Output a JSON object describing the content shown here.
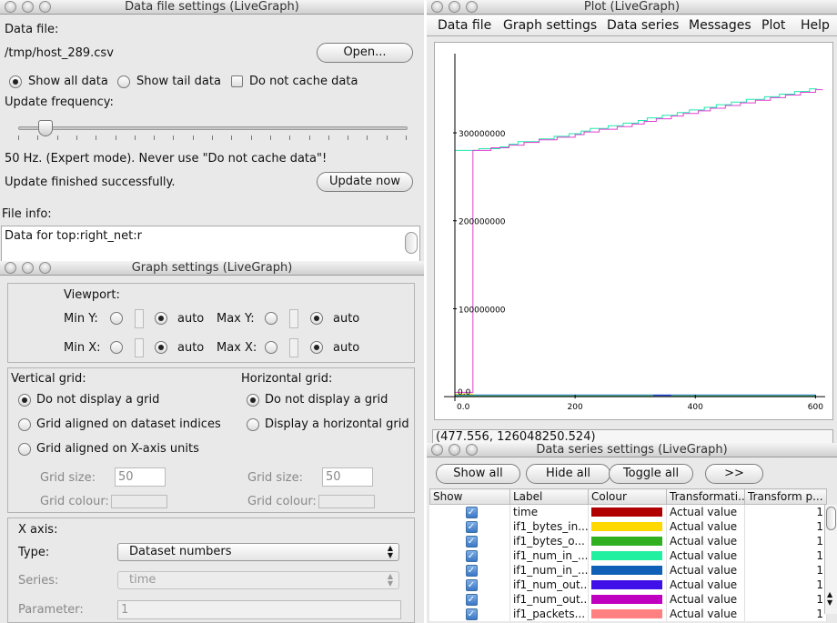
{
  "data_file_window": {
    "title": "Data file settings (LiveGraph)",
    "data_file_label": "Data file:",
    "file_path": "/tmp/host_289.csv",
    "open_button": "Open...",
    "show_all_label": "Show all data",
    "show_tail_label": "Show tail data",
    "no_cache_label": "Do not cache data",
    "update_freq_label": "Update frequency:",
    "slider_level": 0.07,
    "freq_status": "50 Hz. (Expert mode). Never use \"Do not cache data\"!",
    "update_status": "Update finished successfully.",
    "update_now_button": "Update now",
    "file_info_label": "File info:",
    "file_info_text": "Data for top:right_net:r"
  },
  "graph_settings_window": {
    "title": "Graph settings (LiveGraph)",
    "viewport_label": "Viewport:",
    "min_y_label": "Min Y:",
    "max_y_label": "Max Y:",
    "min_x_label": "Min X:",
    "max_x_label": "Max X:",
    "auto_label": "auto",
    "vertical_grid_label": "Vertical grid:",
    "horizontal_grid_label": "Horizontal grid:",
    "v_no_grid": "Do not display a grid",
    "v_grid_indices": "Grid aligned on dataset indices",
    "v_grid_xunits": "Grid aligned on X-axis units",
    "h_no_grid": "Do not display a grid",
    "h_grid": "Display a horizontal grid",
    "grid_size_label": "Grid size:",
    "grid_size_value": "50",
    "grid_colour_label": "Grid colour:",
    "x_axis_label": "X axis:",
    "type_label": "Type:",
    "type_value": "Dataset numbers",
    "series_label": "Series:",
    "series_value": "time",
    "parameter_label": "Parameter:",
    "parameter_value": "1"
  },
  "plot_window": {
    "title": "Plot (LiveGraph)",
    "menu": [
      "Data file",
      "Graph settings",
      "Data series",
      "Messages",
      "Plot",
      "Help"
    ],
    "coord_readout": "(477.556, 126048250.524)",
    "chart_data": {
      "type": "line",
      "y_tick_labels": [
        "100000000",
        "200000000",
        "300000000"
      ],
      "y_ticks": [
        100000000,
        200000000,
        300000000
      ],
      "x_tick_labels": [
        "0.0",
        "200",
        "400",
        "600"
      ],
      "x_ticks": [
        0,
        200,
        400,
        600
      ],
      "xlim": [
        0,
        610
      ],
      "ylim": [
        -5000000,
        390000000
      ],
      "origin_label": "0.0",
      "series": [
        {
          "color": "#20e8b0",
          "x": [
            0,
            40,
            75,
            90,
            105,
            140,
            165,
            190,
            210,
            225,
            255,
            280,
            305,
            320,
            345,
            370,
            390,
            415,
            435,
            460,
            485,
            515,
            540,
            565,
            590
          ],
          "y": [
            280000000,
            282000000,
            284000000,
            287000000,
            290000000,
            293000000,
            296000000,
            299000000,
            302000000,
            305000000,
            308000000,
            311000000,
            314000000,
            317000000,
            320000000,
            323000000,
            326000000,
            329000000,
            332000000,
            335000000,
            338000000,
            341000000,
            344000000,
            347000000,
            350000000
          ]
        },
        {
          "color": "#e040d0",
          "x": [
            0,
            30,
            60,
            90,
            115,
            140,
            170,
            200,
            215,
            240,
            270,
            295,
            315,
            335,
            360,
            380,
            405,
            425,
            450,
            475,
            500,
            525,
            550,
            575,
            600
          ],
          "y": [
            5000000,
            280000000,
            283000000,
            286000000,
            289000000,
            292000000,
            295000000,
            298000000,
            301000000,
            304000000,
            307000000,
            310000000,
            313000000,
            316000000,
            319000000,
            322000000,
            325000000,
            328000000,
            331000000,
            334000000,
            337000000,
            340000000,
            343000000,
            346000000,
            349000000
          ]
        },
        {
          "color": "#1a7fd0",
          "x": [
            0,
            600
          ],
          "y": [
            2000000,
            2000000
          ]
        },
        {
          "color": "#3aa040",
          "x": [
            0,
            600
          ],
          "y": [
            1000000,
            1000000
          ]
        },
        {
          "color": "#ffd000",
          "x": [
            0,
            30
          ],
          "y": [
            3000000,
            3000000
          ]
        },
        {
          "color": "#2020e0",
          "x": [
            330,
            360
          ],
          "y": [
            1500000,
            1500000
          ]
        }
      ]
    }
  },
  "data_series_window": {
    "title": "Data series settings (LiveGraph)",
    "buttons": [
      "Show all",
      "Hide all",
      "Toggle all",
      ">>"
    ],
    "columns": [
      "Show",
      "Label",
      "Colour",
      "Transformati...",
      "Transform p..."
    ],
    "rows": [
      {
        "label": "time",
        "colour": "#b00000",
        "transform": "Actual value",
        "param": "1"
      },
      {
        "label": "if1_bytes_in...",
        "colour": "#ffd800",
        "transform": "Actual value",
        "param": "1"
      },
      {
        "label": "if1_bytes_o...",
        "colour": "#30b020",
        "transform": "Actual value",
        "param": "1"
      },
      {
        "label": "if1_num_in_...",
        "colour": "#20f0a0",
        "transform": "Actual value",
        "param": "1"
      },
      {
        "label": "if1_num_in_...",
        "colour": "#1060b8",
        "transform": "Actual value",
        "param": "1"
      },
      {
        "label": "if1_num_out...",
        "colour": "#4010e8",
        "transform": "Actual value",
        "param": "1"
      },
      {
        "label": "if1_num_out...",
        "colour": "#c000c0",
        "transform": "Actual value",
        "param": "1"
      },
      {
        "label": "if1_packets...",
        "colour": "#ff8080",
        "transform": "Actual value",
        "param": "1"
      }
    ]
  }
}
